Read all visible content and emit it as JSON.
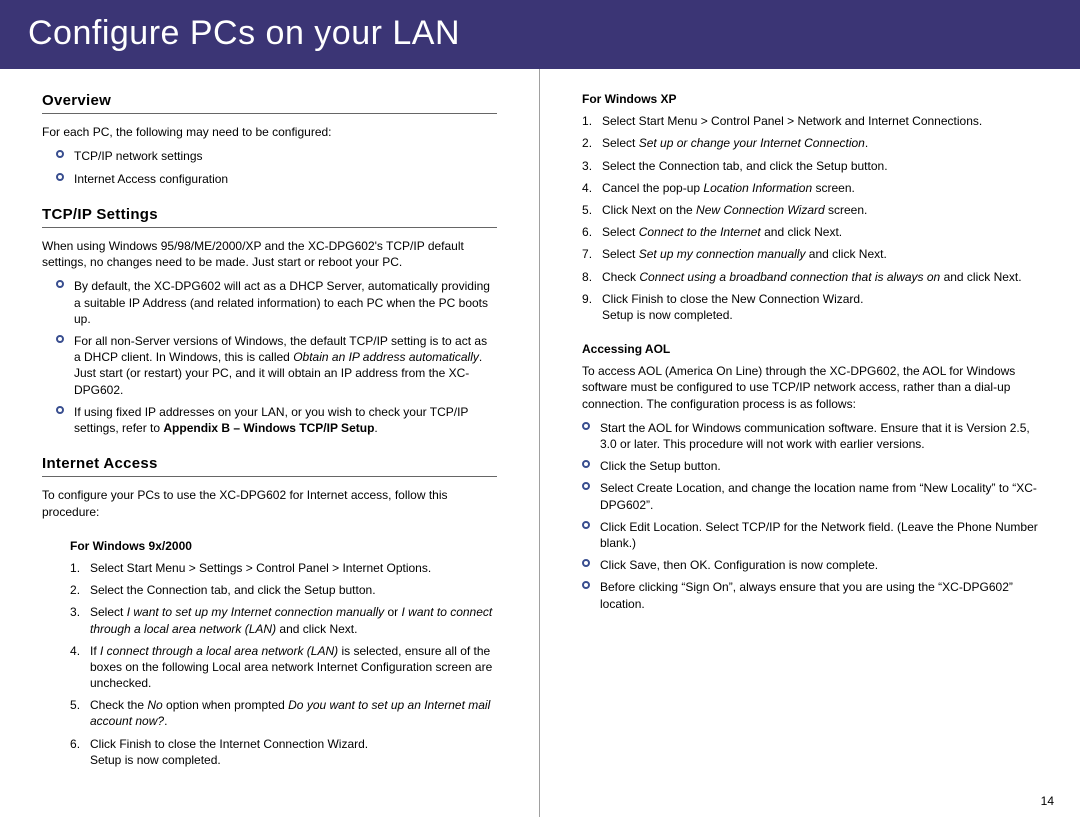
{
  "banner": "Configure PCs on your LAN",
  "page_number": "14",
  "left": {
    "overview": {
      "head": "Overview",
      "intro": "For each PC, the following may need to be configured:",
      "bullets": [
        "TCP/IP network settings",
        "Internet Access configuration"
      ]
    },
    "tcpip": {
      "head": "TCP/IP Settings",
      "intro": "When using Windows 95/98/ME/2000/XP and the XC-DPG602's TCP/IP default settings, no changes need to be made. Just start or reboot your PC.",
      "bullet1": "By default, the XC-DPG602 will act as a DHCP Server, automatically providing a suitable IP Address (and related information) to each PC when the PC boots up.",
      "bullet2_a": "For all non-Server versions of Windows, the default TCP/IP setting is to act as a DHCP client. In Windows, this is called ",
      "bullet2_i": "Obtain an IP address automatically",
      "bullet2_b": ". Just start (or restart) your PC, and it will obtain an IP address from the XC-DPG602.",
      "bullet3_a": "If using fixed IP addresses on your LAN, or you wish to check your TCP/IP settings, refer to ",
      "bullet3_bold": "Appendix B – Windows TCP/IP Setup",
      "bullet3_b": "."
    },
    "internet": {
      "head": "Internet Access",
      "intro": "To configure your PCs to use the XC-DPG602 for Internet access, follow this procedure:",
      "win9x": {
        "subhead": "For Windows 9x/2000",
        "s1": "Select Start Menu > Settings > Control Panel > Internet Options.",
        "s2": "Select the Connection tab, and click the Setup button.",
        "s3_a": "Select ",
        "s3_i1": "I want to set up my Internet connection manually",
        "s3_mid": " or ",
        "s3_i2": "I want to connect through a local area network (LAN)",
        "s3_b": " and click Next.",
        "s4_a": "If ",
        "s4_i": "I connect through a local area network (LAN)",
        "s4_b": " is selected, ensure all of the boxes on the following Local area network Internet Configuration screen are unchecked.",
        "s5_a": "Check the ",
        "s5_i1": "No",
        "s5_mid": " option when prompted ",
        "s5_i2": "Do you want to set up an Internet mail account now?",
        "s5_b": ".",
        "s6_a": "Click Finish to close the Internet Connection Wizard.",
        "s6_b": "Setup is now completed."
      }
    }
  },
  "right": {
    "winxp": {
      "subhead": "For Windows XP",
      "s1": "Select Start Menu > Control Panel > Network and Internet Connections.",
      "s2_a": "Select ",
      "s2_i": "Set up or change your Internet Connection",
      "s2_b": ".",
      "s3": "Select the Connection tab, and click the Setup button.",
      "s4_a": "Cancel the pop-up ",
      "s4_i": "Location Information",
      "s4_b": " screen.",
      "s5_a": "Click Next on the ",
      "s5_i": "New Connection Wizard",
      "s5_b": " screen.",
      "s6_a": "Select ",
      "s6_i": "Connect to the Internet",
      "s6_b": " and click Next.",
      "s7_a": "Select ",
      "s7_i": "Set up my connection manually",
      "s7_b": " and click Next.",
      "s8_a": "Check ",
      "s8_i": "Connect using a broadband connection that is always on",
      "s8_b": " and click Next.",
      "s9_a": "Click Finish to close the New Connection Wizard.",
      "s9_b": "Setup is now completed."
    },
    "aol": {
      "subhead": "Accessing AOL",
      "intro": "To access AOL (America On Line) through the XC-DPG602, the AOL for Windows software must be configured to use TCP/IP network access, rather than a dial-up connection. The configuration process is as follows:",
      "b1": "Start the AOL for Windows communication software. Ensure that it is Version 2.5, 3.0 or later. This procedure will not work with earlier versions.",
      "b2": "Click the Setup button.",
      "b3": "Select Create Location, and change the location name from “New Locality” to “XC-DPG602”.",
      "b4": "Click Edit Location. Select TCP/IP for the Network field. (Leave the Phone Number blank.)",
      "b5": "Click Save, then OK. Configuration is now complete.",
      "b6": "Before clicking “Sign On”, always ensure that you are using the “XC-DPG602” location."
    }
  }
}
